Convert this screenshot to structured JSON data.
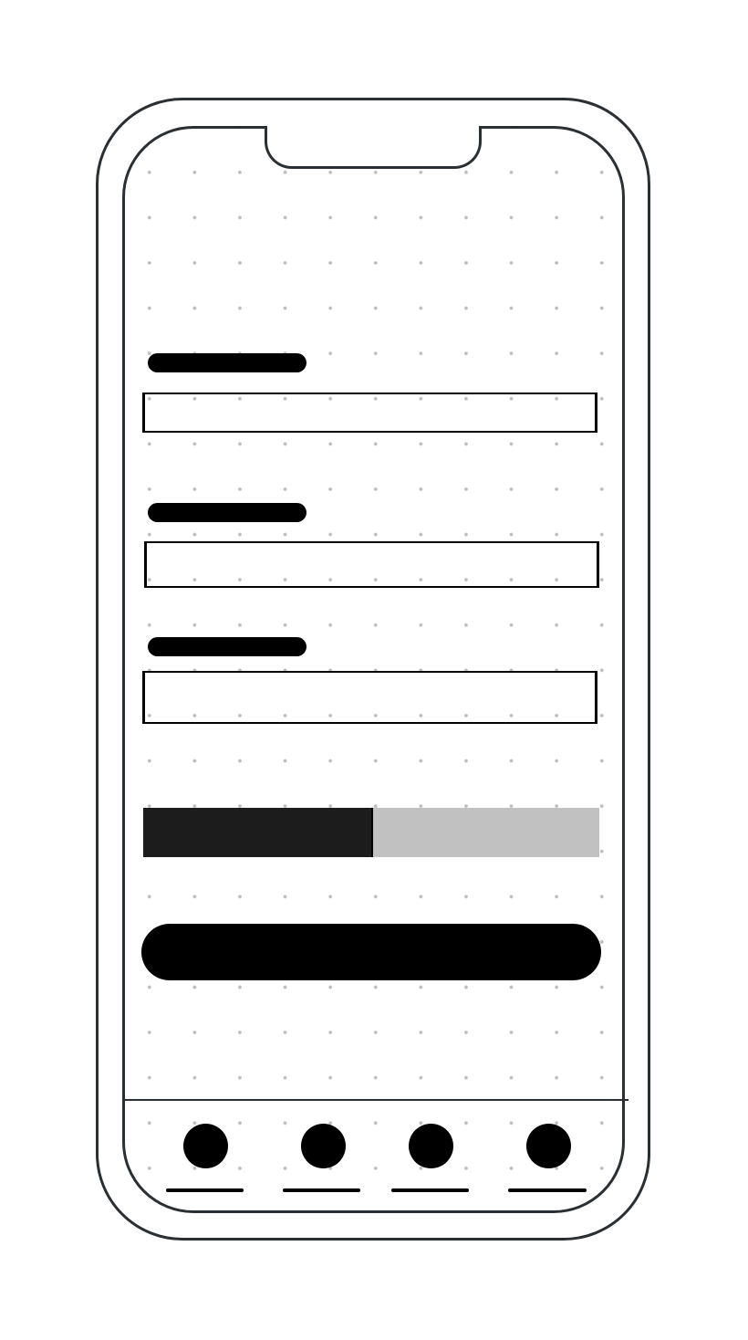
{
  "screen": {
    "type": "mobile-wireframe",
    "form": {
      "fields": [
        {
          "label": "",
          "value": "",
          "placeholder": ""
        },
        {
          "label": "",
          "value": "",
          "placeholder": ""
        },
        {
          "label": "",
          "value": "",
          "placeholder": ""
        }
      ],
      "progress": {
        "fraction": 0.5
      },
      "submit": {
        "label": ""
      }
    },
    "tabbar": {
      "items": [
        {
          "icon": "circle-icon",
          "label": ""
        },
        {
          "icon": "circle-icon",
          "label": ""
        },
        {
          "icon": "circle-icon",
          "label": ""
        },
        {
          "icon": "circle-icon",
          "label": ""
        }
      ]
    }
  },
  "colors": {
    "frame": "#2a2f33",
    "ink": "#000000",
    "progress_fill": "#1c1c1c",
    "progress_track": "#c1c1c1",
    "grid_dot": "#bdbdbd",
    "background": "#ffffff"
  }
}
